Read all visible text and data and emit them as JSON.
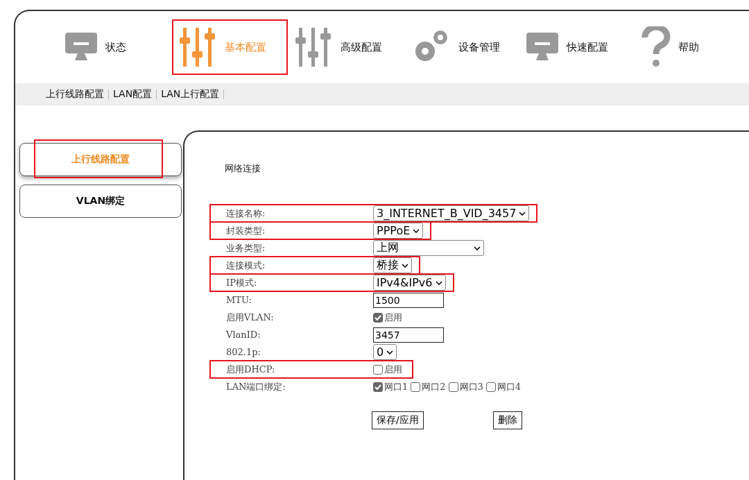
{
  "nav": [
    {
      "label": "状态",
      "selected": false,
      "highlighted": false
    },
    {
      "label": "基本配置",
      "selected": true,
      "highlighted": true
    },
    {
      "label": "高级配置",
      "selected": false,
      "highlighted": false
    },
    {
      "label": "设备管理",
      "selected": false,
      "highlighted": false
    },
    {
      "label": "快速配置",
      "selected": false,
      "highlighted": false
    },
    {
      "label": "帮助",
      "selected": false,
      "highlighted": false
    }
  ],
  "subnav": [
    "上行线路配置",
    "LAN配置",
    "LAN上行配置"
  ],
  "sidebar": {
    "items": [
      {
        "label": "上行线路配置",
        "selected": true,
        "highlighted": true
      },
      {
        "label": "VLAN绑定",
        "selected": false,
        "highlighted": false
      }
    ]
  },
  "form": {
    "title": "网络连接",
    "rows": [
      {
        "label": "连接名称:",
        "kind": "select",
        "value": "3_INTERNET_B_VID_3457",
        "highlighted": true
      },
      {
        "label": "封装类型:",
        "kind": "select",
        "value": "PPPoE",
        "highlighted": true
      },
      {
        "label": "业务类型:",
        "kind": "select",
        "value": "上网",
        "highlighted": false
      },
      {
        "label": "连接模式:",
        "kind": "select",
        "value": "桥接",
        "highlighted": true
      },
      {
        "label": "IP模式:",
        "kind": "select",
        "value": "IPv4&IPv6",
        "highlighted": true
      },
      {
        "label": "MTU:",
        "kind": "input",
        "value": "1500",
        "highlighted": false
      },
      {
        "label": "启用VLAN:",
        "kind": "checkbox",
        "options": [
          {
            "label": "启用",
            "checked": true
          }
        ],
        "highlighted": false
      },
      {
        "label": "VlanID:",
        "kind": "input",
        "value": "3457",
        "highlighted": false
      },
      {
        "label": "802.1p:",
        "kind": "select",
        "value": "0",
        "highlighted": false
      },
      {
        "label": "启用DHCP:",
        "kind": "checkbox",
        "options": [
          {
            "label": "启用",
            "checked": false
          }
        ],
        "highlighted": true
      },
      {
        "label": "LAN端口绑定:",
        "kind": "checkbox",
        "options": [
          {
            "label": "网口1",
            "checked": true
          },
          {
            "label": "网口2",
            "checked": false
          },
          {
            "label": "网口3",
            "checked": false
          },
          {
            "label": "网口4",
            "checked": false
          }
        ],
        "highlighted": false
      }
    ],
    "buttons": [
      "保存/应用",
      "删除"
    ]
  }
}
